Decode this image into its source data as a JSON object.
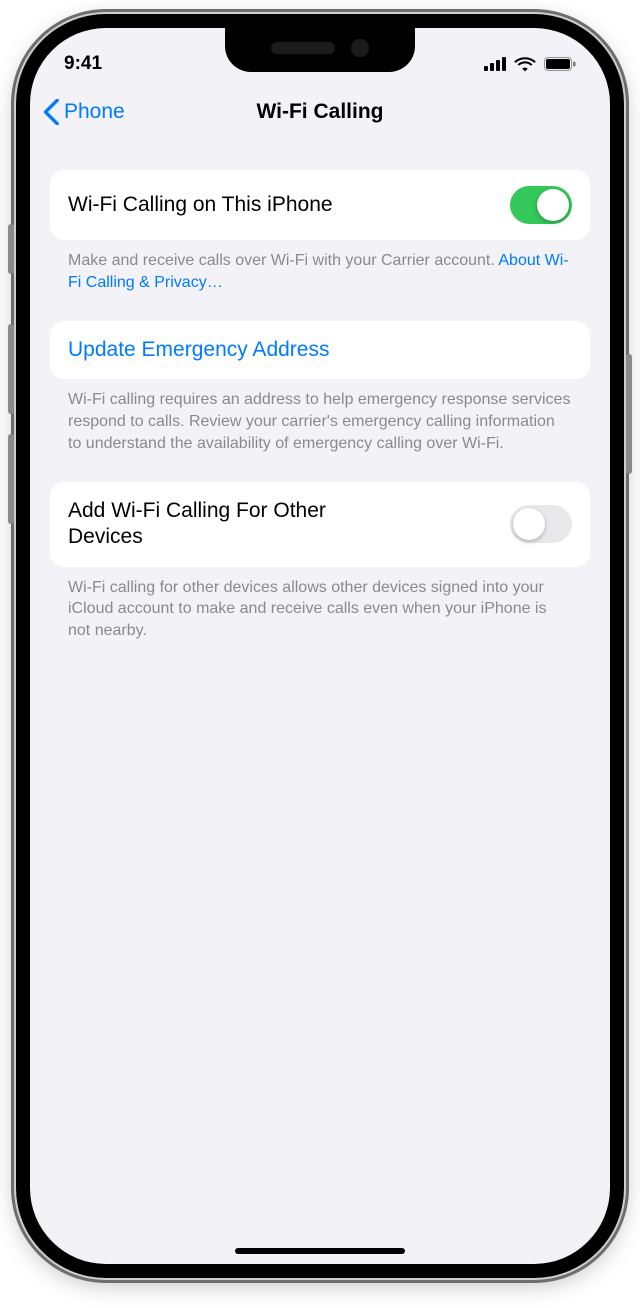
{
  "status": {
    "time": "9:41"
  },
  "nav": {
    "back_label": "Phone",
    "title": "Wi-Fi Calling"
  },
  "g1": {
    "label": "Wi-Fi Calling on This iPhone",
    "on": true,
    "footer_text": "Make and receive calls over Wi-Fi with your Carrier account. ",
    "footer_link": "About Wi-Fi Calling & Privacy…"
  },
  "g2": {
    "label": "Update Emergency Address",
    "footer": "Wi-Fi calling requires an address to help emergency response services respond to calls. Review your carrier's emergency calling information to understand the availability of emergency calling over Wi-Fi."
  },
  "g3": {
    "label": "Add Wi-Fi Calling For Other Devices",
    "on": false,
    "footer": "Wi-Fi calling for other devices allows other devices signed into your iCloud account to make and receive calls even when your iPhone is not nearby."
  }
}
